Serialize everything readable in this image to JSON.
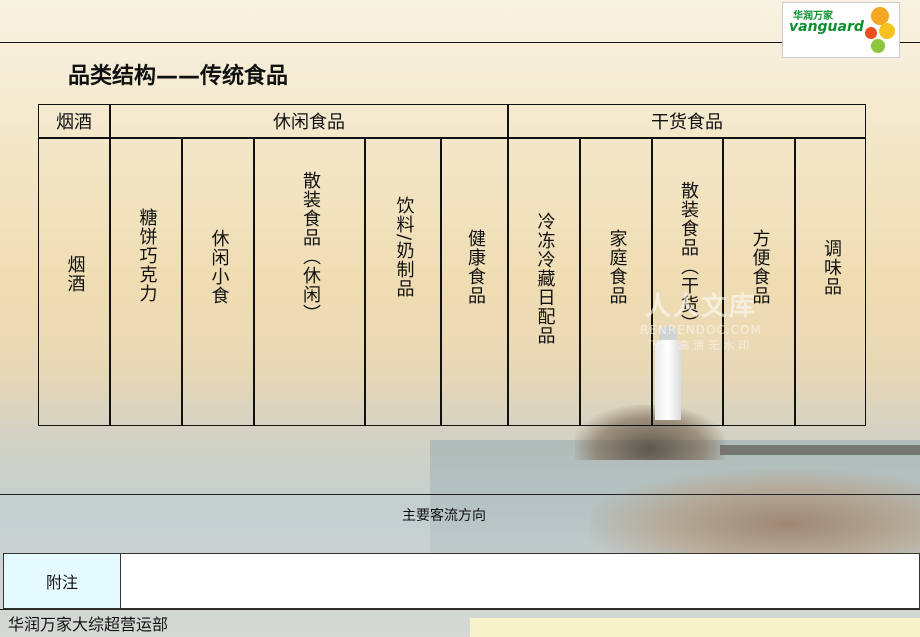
{
  "logo": {
    "cn": "华润万家",
    "en": "vanguard",
    "colors": [
      "#f5a623",
      "#f7c21f",
      "#e94e1b",
      "#8cc63f"
    ]
  },
  "title": "品类结构——传统食品",
  "table": {
    "groups": [
      "烟酒",
      "休闲食品",
      "干货食品"
    ],
    "columns": [
      "烟酒",
      "糖饼巧克力",
      "休闲小食",
      "散装食品（休闲）",
      "饮料/奶制品",
      "健康食品",
      "冷冻冷藏日配品",
      "家庭食品",
      "散装食品（干货）",
      "方便食品",
      "调味品"
    ]
  },
  "flow_label": "主要客流方向",
  "note": {
    "label": "附注",
    "value": ""
  },
  "footer": "华润万家大综超营运部",
  "watermark": {
    "main": "人人文库",
    "sub": "RENRENDOC.COM",
    "tag": "下载高清无水印"
  }
}
